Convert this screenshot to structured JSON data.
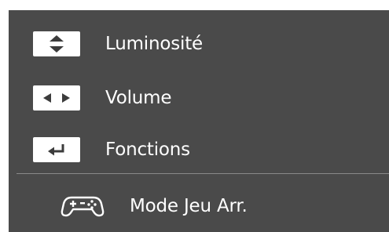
{
  "osd": {
    "items": [
      {
        "label": "Luminosité",
        "key_icon": "up-down-arrows-icon"
      },
      {
        "label": "Volume",
        "key_icon": "left-right-arrows-icon"
      },
      {
        "label": "Fonctions",
        "key_icon": "enter-return-icon"
      }
    ],
    "footer": {
      "label": "Mode Jeu Arr.",
      "icon": "gamepad-icon"
    }
  },
  "colors": {
    "panel_background": "#4a4a4a",
    "text": "#ffffff",
    "key_background": "#ffffff",
    "key_glyph": "#3c3c3c",
    "divider": "#8a8a8a"
  }
}
